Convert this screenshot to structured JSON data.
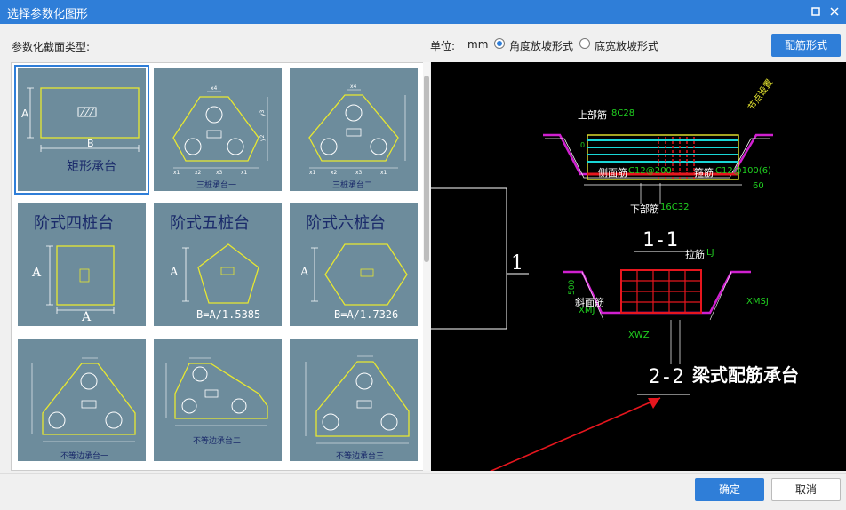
{
  "window": {
    "title": "选择参数化图形",
    "maximize_icon": "maximize-icon",
    "close_icon": "close-icon"
  },
  "section_label": "参数化截面类型:",
  "unit": {
    "label": "单位:",
    "value": "mm"
  },
  "slope_options": [
    {
      "label": "角度放坡形式",
      "selected": true
    },
    {
      "label": "底宽放坡形式",
      "selected": false
    }
  ],
  "rebar_form_button": "配筋形式",
  "shapes": [
    {
      "name": "矩形承台",
      "label_a": "A",
      "label_b": "B",
      "selected": true
    },
    {
      "name": "三桩承台一"
    },
    {
      "name": "三桩承台二"
    },
    {
      "name": "阶式四桩台",
      "label_a": "A",
      "label_b": "A"
    },
    {
      "name": "阶式五桩台",
      "label_a": "A",
      "formula": "B=A/1.5385"
    },
    {
      "name": "阶式六桩台",
      "label_a": "A",
      "formula": "B=A/1.7326"
    },
    {
      "name": "不等边承台一"
    },
    {
      "name": "不等边承台二"
    },
    {
      "name": "不等边承台三"
    }
  ],
  "dimension_labels": {
    "x1": "x1",
    "x2": "x2",
    "x3": "x3",
    "x4": "x4",
    "y1": "y1",
    "y2": "y2",
    "y3": "y3"
  },
  "preview": {
    "top_rebar": "上部筋",
    "top_rebar_value": "8C28",
    "side_rebar": "侧面筋",
    "side_rebar_value": "C12@200",
    "stirrup": "箍筋",
    "stirrup_value": "C12@100(6)",
    "bottom_rebar": "下部筋",
    "bottom_rebar_value": "16C32",
    "section_1": "1-1",
    "marker_1": "1",
    "tie_bar": "拉筋",
    "tie_bar_value": "LJ",
    "slope_rebar": "斜面筋",
    "slope_rebar_value": "XMJ",
    "xmsj": "XMSJ",
    "xwz": "XWZ",
    "section_2": "2-2",
    "caption": "梁式配筋承台",
    "dim_500": "500",
    "dim_60": "60",
    "dim_0": "0",
    "dim_100": "100",
    "dim_1000": "1000",
    "node_note": "节点设置",
    "colors": {
      "concrete": "#c8d00a",
      "rebar": "#e6161e",
      "tie": "#d020d0",
      "stirrup": "#19d6d6",
      "dim": "#ffffff",
      "green": "#20d020"
    }
  },
  "buttons": {
    "ok": "确定",
    "cancel": "取消"
  }
}
